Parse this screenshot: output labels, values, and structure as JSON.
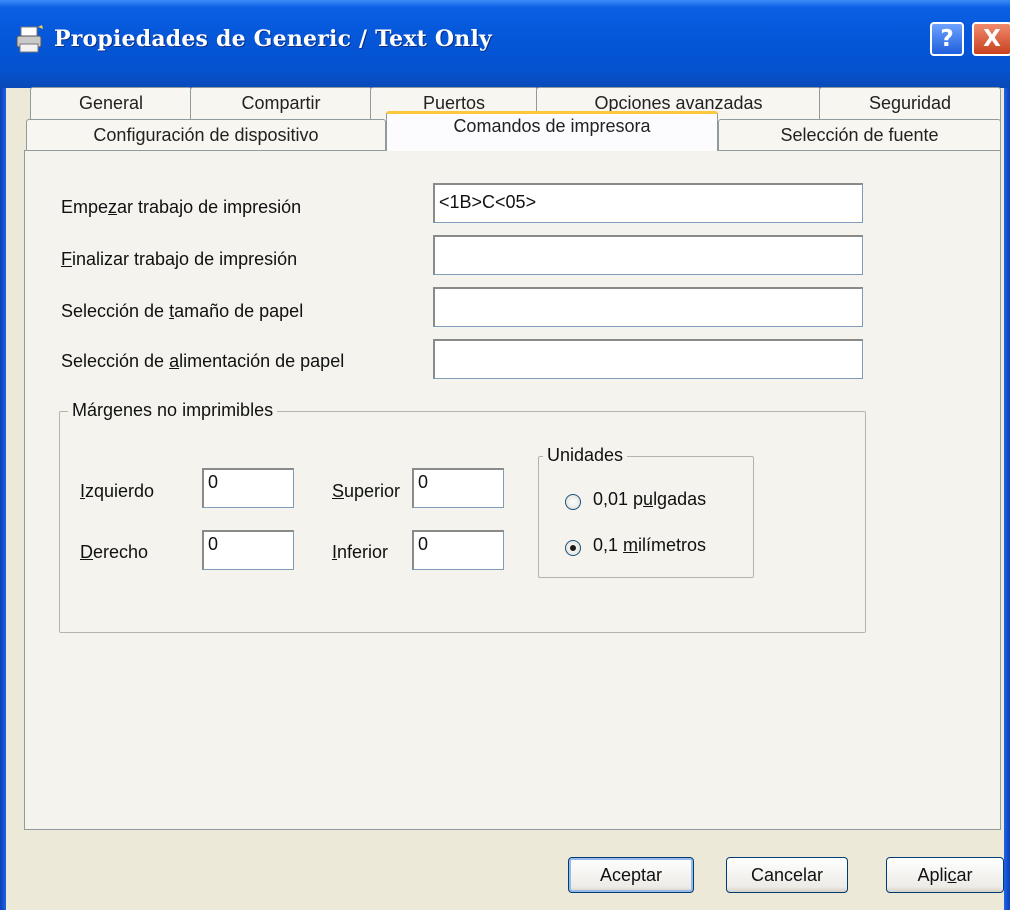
{
  "window": {
    "title": "Propiedades de Generic / Text Only",
    "help_symbol": "?",
    "close_symbol": "X"
  },
  "tabs": {
    "row_back": [
      "General",
      "Compartir",
      "Puertos",
      "Opciones avanzadas",
      "Seguridad"
    ],
    "row_front": [
      "Configuración de dispositivo",
      "Comandos de impresora",
      "Selección de fuente"
    ],
    "active": "Comandos de impresora"
  },
  "fields": [
    {
      "label": "Empezar trabajo de impresión",
      "value": "<1B>C<05>"
    },
    {
      "label": "Finalizar trabajo de impresión",
      "value": ""
    },
    {
      "label": "Selección de tamaño de papel",
      "value": ""
    },
    {
      "label": "Selección de alimentación de papel",
      "value": ""
    }
  ],
  "margins": {
    "legend": "Márgenes no imprimibles",
    "left_label": "Izquierdo",
    "left_value": "0",
    "right_label": "Derecho",
    "right_value": "0",
    "top_label": "Superior",
    "top_value": "0",
    "bottom_label": "Inferior",
    "bottom_value": "0"
  },
  "units": {
    "legend": "Unidades",
    "options": [
      {
        "label": "0,01 pulgadas",
        "checked": false
      },
      {
        "label": "0,1 milímetros",
        "checked": true
      }
    ]
  },
  "buttons": {
    "ok": "Aceptar",
    "cancel": "Cancelar",
    "apply": "Aplicar"
  },
  "colors": {
    "titlebar": "#0556d8",
    "dialog_bg": "#ece9d8",
    "active_tab_accent": "#ffc73d"
  }
}
